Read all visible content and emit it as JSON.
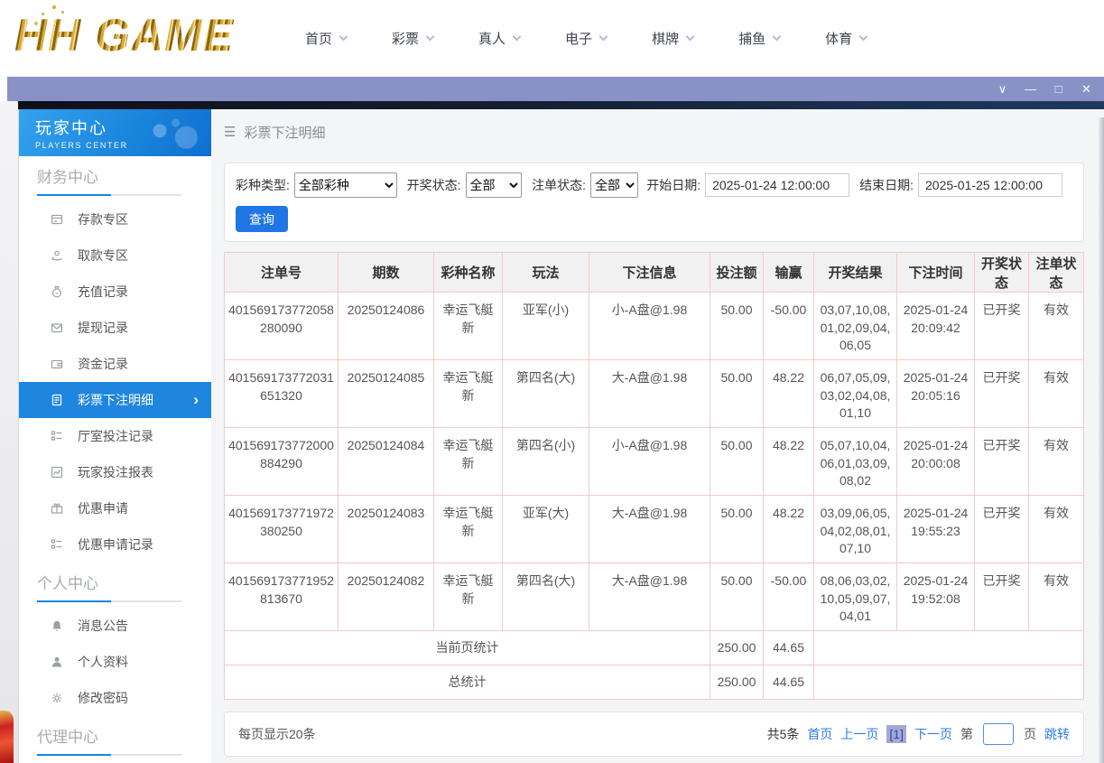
{
  "brand": {
    "logo_text": "HH GAME"
  },
  "top_nav": {
    "items": [
      {
        "label": "首页"
      },
      {
        "label": "彩票"
      },
      {
        "label": "真人"
      },
      {
        "label": "电子"
      },
      {
        "label": "棋牌"
      },
      {
        "label": "捕鱼"
      },
      {
        "label": "体育"
      }
    ]
  },
  "window_controls": [
    {
      "name": "window-menu-button",
      "glyph": "∨"
    },
    {
      "name": "window-minimize-button",
      "glyph": "—"
    },
    {
      "name": "window-maximize-button",
      "glyph": "□"
    },
    {
      "name": "window-close-button",
      "glyph": "✕"
    }
  ],
  "icons": {
    "hamburger": "☰",
    "active_arrow": "›"
  },
  "sidebar": {
    "header": {
      "title": "玩家中心",
      "subtitle": "PLAYERS CENTER"
    },
    "sections": [
      {
        "title": "财务中心",
        "items": [
          {
            "label": "存款专区",
            "icon": "deposit-icon"
          },
          {
            "label": "取款专区",
            "icon": "withdraw-icon"
          },
          {
            "label": "充值记录",
            "icon": "recharge-records-icon"
          },
          {
            "label": "提现记录",
            "icon": "withdrawal-records-icon"
          },
          {
            "label": "资金记录",
            "icon": "funds-records-icon"
          },
          {
            "label": "彩票下注明细",
            "icon": "lottery-bet-details-icon",
            "active": true
          },
          {
            "label": "厅室投注记录",
            "icon": "hall-bet-records-icon"
          },
          {
            "label": "玩家投注报表",
            "icon": "player-bet-report-icon"
          },
          {
            "label": "优惠申请",
            "icon": "promo-apply-icon"
          },
          {
            "label": "优惠申请记录",
            "icon": "promo-apply-records-icon"
          }
        ]
      },
      {
        "title": "个人中心",
        "items": [
          {
            "label": "消息公告",
            "icon": "bell-icon"
          },
          {
            "label": "个人资料",
            "icon": "person-icon"
          },
          {
            "label": "修改密码",
            "icon": "gear-icon"
          }
        ]
      },
      {
        "title": "代理中心",
        "items": []
      }
    ]
  },
  "main": {
    "page_title": "彩票下注明细",
    "filters": {
      "lottery_type_label": "彩种类型:",
      "lottery_type_value": "全部彩种",
      "draw_status_label": "开奖状态:",
      "draw_status_value": "全部",
      "order_status_label": "注单状态:",
      "order_status_value": "全部",
      "start_date_label": "开始日期:",
      "start_date_value": "2025-01-24 12:00:00",
      "end_date_label": "结束日期:",
      "end_date_value": "2025-01-25 12:00:00",
      "search_button": "查询"
    },
    "table": {
      "columns": [
        "注单号",
        "期数",
        "彩种名称",
        "玩法",
        "下注信息",
        "投注额",
        "输赢",
        "开奖结果",
        "下注时间",
        "开奖状态",
        "注单状态"
      ],
      "rows": [
        [
          "401569173772058280090",
          "20250124086",
          "幸运飞艇新",
          "亚军(小)",
          "小-A盘@1.98",
          "50.00",
          "-50.00",
          "03,07,10,08,01,02,09,04,06,05",
          "2025-01-24 20:09:42",
          "已开奖",
          "有效"
        ],
        [
          "401569173772031651320",
          "20250124085",
          "幸运飞艇新",
          "第四名(大)",
          "大-A盘@1.98",
          "50.00",
          "48.22",
          "06,07,05,09,03,02,04,08,01,10",
          "2025-01-24 20:05:16",
          "已开奖",
          "有效"
        ],
        [
          "401569173772000884290",
          "20250124084",
          "幸运飞艇新",
          "第四名(小)",
          "小-A盘@1.98",
          "50.00",
          "48.22",
          "05,07,10,04,06,01,03,09,08,02",
          "2025-01-24 20:00:08",
          "已开奖",
          "有效"
        ],
        [
          "401569173771972380250",
          "20250124083",
          "幸运飞艇新",
          "亚军(大)",
          "大-A盘@1.98",
          "50.00",
          "48.22",
          "03,09,06,05,04,02,08,01,07,10",
          "2025-01-24 19:55:23",
          "已开奖",
          "有效"
        ],
        [
          "401569173771952813670",
          "20250124082",
          "幸运飞艇新",
          "第四名(大)",
          "大-A盘@1.98",
          "50.00",
          "-50.00",
          "08,06,03,02,10,05,09,07,04,01",
          "2025-01-24 19:52:08",
          "已开奖",
          "有效"
        ]
      ],
      "summary": [
        {
          "label": "当前页统计",
          "bet_total": "250.00",
          "win_loss": "44.65"
        },
        {
          "label": "总统计",
          "bet_total": "250.00",
          "win_loss": "44.65"
        }
      ]
    },
    "pagination": {
      "page_size_text": "每页显示20条",
      "total_text": "共5条",
      "first_label": "首页",
      "prev_label": "上一页",
      "current_page": "[1]",
      "next_label": "下一页",
      "jump_prefix": "第",
      "jump_suffix": "页",
      "jump_label": "跳转",
      "jump_input_value": ""
    }
  },
  "colors": {
    "accent_blue": "#1f86e0",
    "link_blue": "#2b7ce9",
    "titlebar_purple": "#8a91c7",
    "table_border_pink": "#f3caca",
    "logo_gold": "#d4a93c",
    "sidebar_header_blue": "#1b86dd"
  }
}
